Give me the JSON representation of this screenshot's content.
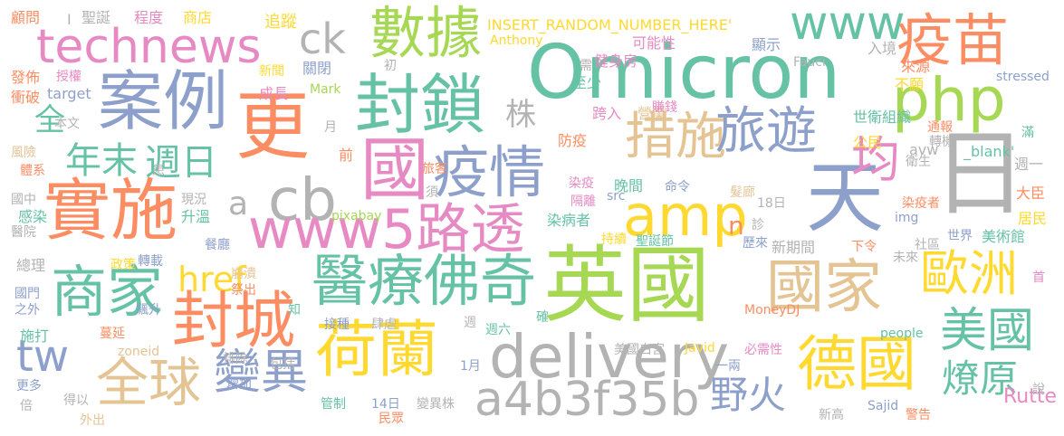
{
  "background": "#ffffff",
  "palette": {
    "teal": "#66c2a5",
    "orange": "#fc8d62",
    "blue": "#8da0cb",
    "pink": "#e78ac3",
    "green": "#a6d854",
    "yellow": "#ffd92f",
    "tan": "#e5c494",
    "gray": "#b3b3b3"
  },
  "words": [
    {
      "text": "Omicron",
      "color": "#66c2a5"
    },
    {
      "text": "英國",
      "color": "#a6d854"
    },
    {
      "text": "technews",
      "color": "#e78ac3"
    },
    {
      "text": "數據",
      "color": "#a6d854"
    },
    {
      "text": "www",
      "color": "#66c2a5"
    },
    {
      "text": "疫苗",
      "color": "#fc8d62"
    },
    {
      "text": "案例",
      "color": "#8da0cb"
    },
    {
      "text": "更",
      "color": "#fc8d62"
    },
    {
      "text": "封鎖",
      "color": "#66c2a5"
    },
    {
      "text": "php",
      "color": "#a6d854"
    },
    {
      "text": "ck",
      "color": "#b3b3b3"
    },
    {
      "text": "國",
      "color": "#e78ac3"
    },
    {
      "text": "措施",
      "color": "#e5c494"
    },
    {
      "text": "旅遊",
      "color": "#8da0cb"
    },
    {
      "text": "疫情",
      "color": "#8da0cb"
    },
    {
      "text": "日",
      "color": "#b3b3b3"
    },
    {
      "text": "天",
      "color": "#8da0cb"
    },
    {
      "text": "均",
      "color": "#e78ac3"
    },
    {
      "text": "年末",
      "color": "#66c2a5"
    },
    {
      "text": "週日",
      "color": "#66c2a5"
    },
    {
      "text": "實施",
      "color": "#fc8d62"
    },
    {
      "text": "cb",
      "color": "#b3b3b3"
    },
    {
      "text": "a",
      "color": "#b3b3b3"
    },
    {
      "text": "amp",
      "color": "#ffd92f"
    },
    {
      "text": "www5路透",
      "color": "#e78ac3"
    },
    {
      "text": "n",
      "color": "#fc8d62"
    },
    {
      "text": "商家",
      "color": "#66c2a5"
    },
    {
      "text": "href",
      "color": "#ffd92f"
    },
    {
      "text": "醫療佛奇",
      "color": "#66c2a5"
    },
    {
      "text": "國家",
      "color": "#e5c494"
    },
    {
      "text": "歐洲",
      "color": "#ffd92f"
    },
    {
      "text": "封城",
      "color": "#fc8d62"
    },
    {
      "text": "tw",
      "color": "#8da0cb"
    },
    {
      "text": "全球",
      "color": "#e5c494"
    },
    {
      "text": "變異",
      "color": "#8da0cb"
    },
    {
      "text": "荷蘭",
      "color": "#ffd92f"
    },
    {
      "text": "delivery",
      "color": "#b3b3b3"
    },
    {
      "text": "a4b3f35b",
      "color": "#b3b3b3"
    },
    {
      "text": "野火",
      "color": "#8da0cb"
    },
    {
      "text": "德國",
      "color": "#ffd92f"
    },
    {
      "text": "美國",
      "color": "#66c2a5"
    },
    {
      "text": "燎原",
      "color": "#66c2a5"
    },
    {
      "text": "Rutte",
      "color": "#e78ac3"
    },
    {
      "text": "全",
      "color": "#66c2a5"
    },
    {
      "text": "株",
      "color": "#b3b3b3"
    },
    {
      "text": "INSERT_RANDOM_NUMBER_HERE'",
      "color": "#ffd92f"
    },
    {
      "text": "Anthony",
      "color": "#ffd92f"
    },
    {
      "text": "顧問",
      "color": "#fc8d62"
    },
    {
      "text": "I",
      "color": "#b3b3b3"
    },
    {
      "text": "聖誕",
      "color": "#b3b3b3"
    },
    {
      "text": "程度",
      "color": "#e78ac3"
    },
    {
      "text": "商店",
      "color": "#ffd92f"
    },
    {
      "text": "追蹤",
      "color": "#ffd92f"
    },
    {
      "text": "可能性",
      "color": "#e78ac3"
    },
    {
      "text": "顯示",
      "color": "#8da0cb"
    },
    {
      "text": "入境",
      "color": "#b3b3b3"
    },
    {
      "text": "健身房",
      "color": "#e78ac3"
    },
    {
      "text": "Fauci",
      "color": "#b3b3b3"
    },
    {
      "text": "來源",
      "color": "#fc8d62"
    },
    {
      "text": "stressed",
      "color": "#8da0cb"
    },
    {
      "text": "發佈",
      "color": "#fc8d62"
    },
    {
      "text": "授權",
      "color": "#e78ac3"
    },
    {
      "text": "新聞",
      "color": "#ffd92f"
    },
    {
      "text": "關閉",
      "color": "#8da0cb"
    },
    {
      "text": "初",
      "color": "#b3b3b3"
    },
    {
      "text": "需",
      "color": "#b3b3b3"
    },
    {
      "text": "不願",
      "color": "#ffd92f"
    },
    {
      "text": "衝破",
      "color": "#fc8d62"
    },
    {
      "text": "target",
      "color": "#8da0cb"
    },
    {
      "text": "Mark",
      "color": "#a6d854"
    },
    {
      "text": "成長",
      "color": "#e78ac3"
    },
    {
      "text": "至少",
      "color": "#66c2a5"
    },
    {
      "text": "營業",
      "color": "#e5c494"
    },
    {
      "text": "賺錢",
      "color": "#e78ac3"
    },
    {
      "text": "世衛組織",
      "color": "#66c2a5"
    },
    {
      "text": "通報",
      "color": "#fc8d62"
    },
    {
      "text": "滿",
      "color": "#66c2a5"
    },
    {
      "text": "本文",
      "color": "#b3b3b3"
    },
    {
      "text": "月",
      "color": "#b3b3b3"
    },
    {
      "text": "跨入",
      "color": "#e78ac3"
    },
    {
      "text": "防疫",
      "color": "#fc8d62"
    },
    {
      "text": "avw",
      "color": "#b3b3b3"
    },
    {
      "text": "轉機",
      "color": "#b3b3b3"
    },
    {
      "text": "風險",
      "color": "#e5c494"
    },
    {
      "text": "前",
      "color": "#fc8d62"
    },
    {
      "text": "旅客",
      "color": "#fc8d62"
    },
    {
      "text": "公民",
      "color": "#ffd92f"
    },
    {
      "text": "衛生",
      "color": "#b3b3b3"
    },
    {
      "text": "_blank'",
      "color": "#66c2a5"
    },
    {
      "text": "週一",
      "color": "#b3b3b3"
    },
    {
      "text": "體系",
      "color": "#fc8d62"
    },
    {
      "text": "患",
      "color": "#b3b3b3"
    },
    {
      "text": "晚間",
      "color": "#66c2a5"
    },
    {
      "text": "命令",
      "color": "#8da0cb"
    },
    {
      "text": "髮廊",
      "color": "#e5c494"
    },
    {
      "text": "國中",
      "color": "#b3b3b3"
    },
    {
      "text": "現況",
      "color": "#b3b3b3"
    },
    {
      "text": "須",
      "color": "#b3b3b3"
    },
    {
      "text": "染疫",
      "color": "#e78ac3"
    },
    {
      "text": "src",
      "color": "#8da0cb"
    },
    {
      "text": "隔離",
      "color": "#e78ac3"
    },
    {
      "text": "18日",
      "color": "#b3b3b3"
    },
    {
      "text": "染疫者",
      "color": "#fc8d62"
    },
    {
      "text": "大臣",
      "color": "#fc8d62"
    },
    {
      "text": "感染",
      "color": "#66c2a5"
    },
    {
      "text": "升溫",
      "color": "#66c2a5"
    },
    {
      "text": "染病者",
      "color": "#66c2a5"
    },
    {
      "text": "img",
      "color": "#8da0cb"
    },
    {
      "text": "居民",
      "color": "#ffd92f"
    },
    {
      "text": "醫院",
      "color": "#b3b3b3"
    },
    {
      "text": "pixabay",
      "color": "#a6d854"
    },
    {
      "text": "診",
      "color": "#b3b3b3"
    },
    {
      "text": "世界",
      "color": "#8da0cb"
    },
    {
      "text": "美術館",
      "color": "#66c2a5"
    },
    {
      "text": "餐廳",
      "color": "#8da0cb"
    },
    {
      "text": "持續",
      "color": "#ffd92f"
    },
    {
      "text": "聖誕節",
      "color": "#66c2a5"
    },
    {
      "text": "歷來",
      "color": "#8da0cb"
    },
    {
      "text": "新期間",
      "color": "#b3b3b3"
    },
    {
      "text": "下令",
      "color": "#fc8d62"
    },
    {
      "text": "社區",
      "color": "#b3b3b3"
    },
    {
      "text": "總理",
      "color": "#b3b3b3"
    },
    {
      "text": "政策",
      "color": "#ffd92f"
    },
    {
      "text": "轉載",
      "color": "#8da0cb"
    },
    {
      "text": "崩潰",
      "color": "#e5c494"
    },
    {
      "text": "祭出",
      "color": "#fc8d62"
    },
    {
      "text": "未來",
      "color": "#b3b3b3"
    },
    {
      "text": "國門",
      "color": "#8da0cb"
    },
    {
      "text": "知",
      "color": "#66c2a5"
    },
    {
      "text": "首",
      "color": "#e78ac3"
    },
    {
      "text": "之外",
      "color": "#8da0cb"
    },
    {
      "text": "飆升",
      "color": "#8da0cb"
    },
    {
      "text": "接種",
      "color": "#8da0cb"
    },
    {
      "text": "肆虐",
      "color": "#b3b3b3"
    },
    {
      "text": "確",
      "color": "#66c2a5"
    },
    {
      "text": "MoneyDJ",
      "color": "#fc8d62"
    },
    {
      "text": "施打",
      "color": "#66c2a5"
    },
    {
      "text": "週",
      "color": "#b3b3b3"
    },
    {
      "text": "週六",
      "color": "#66c2a5"
    },
    {
      "text": "people",
      "color": "#66c2a5"
    },
    {
      "text": "蔓延",
      "color": "#fc8d62"
    },
    {
      "text": "zoneid",
      "color": "#e5c494"
    },
    {
      "text": "美國白宮",
      "color": "#b3b3b3"
    },
    {
      "text": "Javid",
      "color": "#ffd92f"
    },
    {
      "text": "必需性",
      "color": "#e78ac3"
    },
    {
      "text": "排除",
      "color": "#b3b3b3"
    },
    {
      "text": "包括",
      "color": "#b3b3b3"
    },
    {
      "text": "1月",
      "color": "#8da0cb"
    },
    {
      "text": "一兩",
      "color": "#8da0cb"
    },
    {
      "text": "更多",
      "color": "#8da0cb"
    },
    {
      "text": "得以",
      "color": "#b3b3b3"
    },
    {
      "text": "增加",
      "color": "#8da0cb"
    },
    {
      "text": "說",
      "color": "#b3b3b3"
    },
    {
      "text": "倍",
      "color": "#b3b3b3"
    },
    {
      "text": "管制",
      "color": "#66c2a5"
    },
    {
      "text": "14日",
      "color": "#8da0cb"
    },
    {
      "text": "變異株",
      "color": "#b3b3b3"
    },
    {
      "text": "新高",
      "color": "#b3b3b3"
    },
    {
      "text": "Sajid",
      "color": "#8da0cb"
    },
    {
      "text": "警告",
      "color": "#fc8d62"
    },
    {
      "text": "外出",
      "color": "#e5c494"
    },
    {
      "text": "民眾",
      "color": "#fc8d62"
    }
  ]
}
